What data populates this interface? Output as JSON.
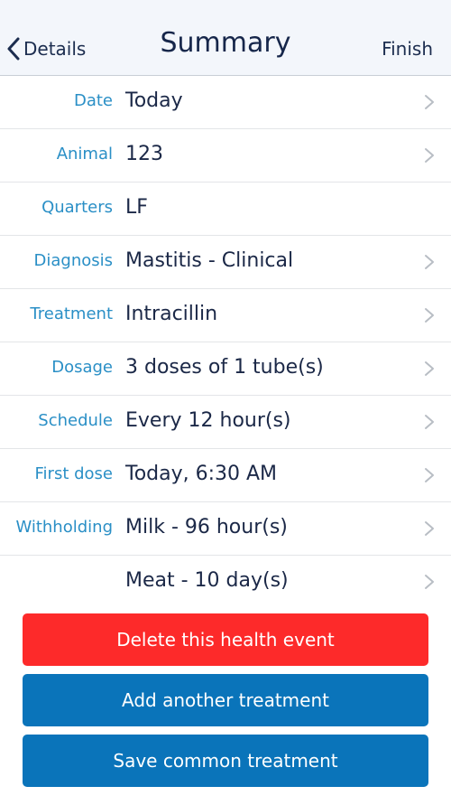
{
  "nav": {
    "back_label": "Details",
    "title": "Summary",
    "finish_label": "Finish"
  },
  "rows": [
    {
      "label": "Date",
      "value": "Today",
      "chevron": true
    },
    {
      "label": "Animal",
      "value": "123",
      "chevron": true
    },
    {
      "label": "Quarters",
      "value": "LF",
      "chevron": false
    },
    {
      "label": "Diagnosis",
      "value": "Mastitis - Clinical",
      "chevron": true
    },
    {
      "label": "Treatment",
      "value": "Intracillin",
      "chevron": true
    },
    {
      "label": "Dosage",
      "value": "3 doses of 1 tube(s)",
      "chevron": true
    },
    {
      "label": "Schedule",
      "value": "Every 12 hour(s)",
      "chevron": true
    },
    {
      "label": "First dose",
      "value": "Today, 6:30 AM",
      "chevron": true
    },
    {
      "label": "Withholding",
      "value": "Milk - 96 hour(s)",
      "chevron": true
    },
    {
      "label": "",
      "value": "Meat - 10 day(s)",
      "chevron": true
    }
  ],
  "buttons": {
    "delete_label": "Delete this health event",
    "add_label": "Add another treatment",
    "save_label": "Save common treatment"
  },
  "colors": {
    "label_blue": "#2a8fc6",
    "value_navy": "#1b2847",
    "delete_red": "#fd2a2a",
    "action_blue": "#0a74ba",
    "nav_bg": "#f3f6fb"
  },
  "icons": {
    "back": "chevron-left-icon",
    "row": "chevron-right-icon"
  }
}
